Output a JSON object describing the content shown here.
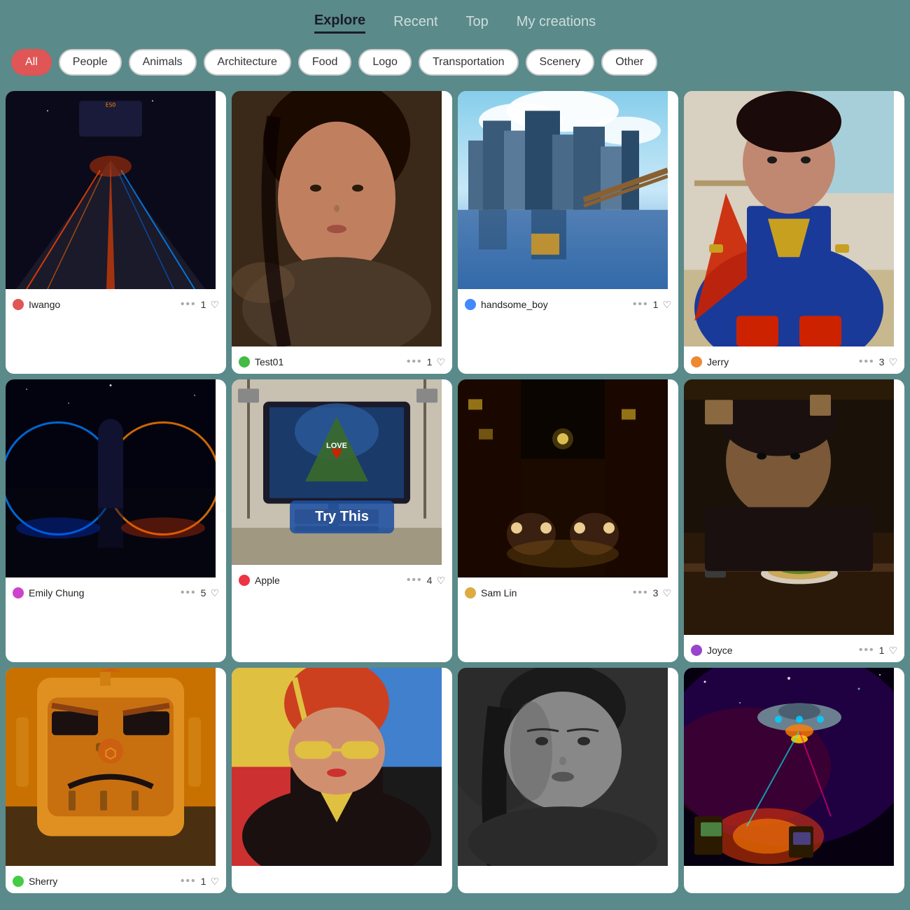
{
  "nav": {
    "items": [
      {
        "label": "Explore",
        "active": true
      },
      {
        "label": "Recent",
        "active": false
      },
      {
        "label": "Top",
        "active": false
      },
      {
        "label": "My creations",
        "active": false
      }
    ]
  },
  "filters": {
    "pills": [
      {
        "label": "All",
        "active": true
      },
      {
        "label": "People",
        "active": false
      },
      {
        "label": "Animals",
        "active": false
      },
      {
        "label": "Architecture",
        "active": false
      },
      {
        "label": "Food",
        "active": false
      },
      {
        "label": "Logo",
        "active": false
      },
      {
        "label": "Transportation",
        "active": false
      },
      {
        "label": "Scenery",
        "active": false
      },
      {
        "label": "Other",
        "active": false
      }
    ]
  },
  "cards": [
    {
      "id": "c1",
      "bg": "dark-road",
      "user": "Iwango",
      "avatar_color": "#e05555",
      "dots": "•••",
      "likes": "1",
      "has_try_this": false,
      "col": 1,
      "row": 1
    },
    {
      "id": "c2",
      "bg": "portrait-woman",
      "user": "Test01",
      "avatar_color": "#44bb44",
      "dots": "•••",
      "likes": "1",
      "has_try_this": false,
      "col": 2,
      "row": 1,
      "tall": true
    },
    {
      "id": "c3",
      "bg": "city-skyline",
      "user": "handsome_boy",
      "avatar_color": "#4488ff",
      "dots": "•••",
      "likes": "1",
      "has_try_this": false,
      "col": 3,
      "row": 1
    },
    {
      "id": "c4",
      "bg": "superwoman",
      "user": "Jerry",
      "avatar_color": "#ee8833",
      "dots": "•••",
      "likes": "3",
      "has_try_this": false,
      "col": 4,
      "row": 1,
      "tall": true
    },
    {
      "id": "c5",
      "bg": "neon-person",
      "user": "Emily Chung",
      "avatar_color": "#cc44cc",
      "dots": "•••",
      "likes": "5",
      "has_try_this": false,
      "col": 1,
      "row": 2
    },
    {
      "id": "c6",
      "bg": "studio-screen",
      "user": "Apple",
      "avatar_color": "#ee3344",
      "dots": "•••",
      "likes": "4",
      "has_try_this": true,
      "try_this_label": "Try This",
      "col": 2,
      "row": 2
    },
    {
      "id": "c7",
      "bg": "dark-alley",
      "user": "Sam Lin",
      "avatar_color": "#ddaa44",
      "dots": "•••",
      "likes": "3",
      "has_try_this": false,
      "col": 3,
      "row": 2
    },
    {
      "id": "c8",
      "bg": "woman-kitchen",
      "user": "Joyce",
      "avatar_color": "#9944cc",
      "dots": "•••",
      "likes": "1",
      "has_try_this": false,
      "col": 4,
      "row": 2,
      "tall": true
    },
    {
      "id": "c9",
      "bg": "robot-yellow",
      "user": "Sherry",
      "avatar_color": "#44cc44",
      "dots": "•••",
      "likes": "1",
      "has_try_this": false,
      "col": 1,
      "row": 3
    },
    {
      "id": "c10",
      "bg": "superhero-woman",
      "user": "",
      "avatar_color": "#888",
      "dots": "",
      "likes": "",
      "has_try_this": false,
      "col": 2,
      "row": 3,
      "no_footer": true
    },
    {
      "id": "c11",
      "bg": "woman-bw",
      "user": "",
      "avatar_color": "#888",
      "dots": "",
      "likes": "",
      "has_try_this": false,
      "col": 3,
      "row": 3,
      "no_footer": true
    },
    {
      "id": "c12",
      "bg": "space-game",
      "user": "",
      "avatar_color": "#888",
      "dots": "",
      "likes": "",
      "has_try_this": false,
      "col": 4,
      "row": 3,
      "no_footer": true
    }
  ]
}
